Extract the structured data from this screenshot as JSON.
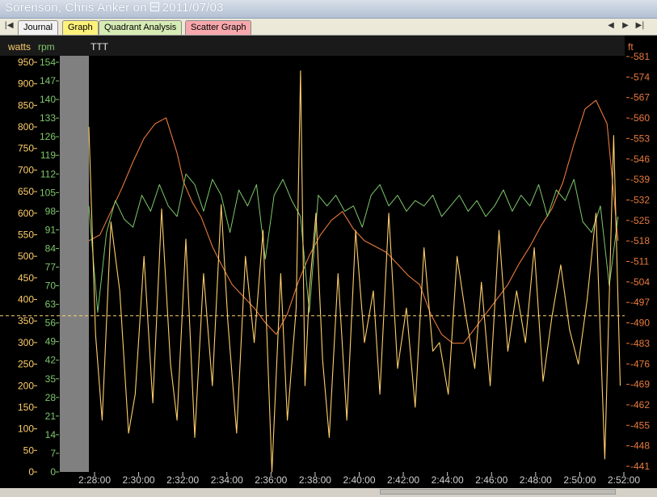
{
  "window": {
    "athlete": "Sorenson, Chris Anker on",
    "date": "2011/07/03"
  },
  "tabs": [
    {
      "label": "Journal",
      "color": "#f2f2f2"
    },
    {
      "label": "Graph",
      "color": "#fff27a"
    },
    {
      "label": "Quadrant Analysis",
      "color": "#d6ecb4"
    },
    {
      "label": "Scatter Graph",
      "color": "#f6a8ad"
    }
  ],
  "colors": {
    "watts": "#ffcf6a",
    "rpm": "#7ec86b",
    "altitude": "#e87a3c",
    "background": "#000000",
    "gray_band": "#808080"
  },
  "chart_data": {
    "type": "line",
    "title": "TTT",
    "axis_labels": {
      "watts": "watts",
      "rpm": "rpm",
      "altitude": "ft"
    },
    "watts_ticks": [
      "950",
      "900",
      "850",
      "800",
      "750",
      "700",
      "650",
      "600",
      "550",
      "500",
      "450",
      "400",
      "350",
      "300",
      "250",
      "200",
      "150",
      "100",
      "50",
      "0"
    ],
    "rpm_ticks": [
      "154",
      "147",
      "140",
      "133",
      "126",
      "119",
      "112",
      "105",
      "98",
      "91",
      "84",
      "77",
      "70",
      "63",
      "56",
      "49",
      "42",
      "35",
      "28",
      "21",
      "14",
      "7",
      "0"
    ],
    "ft_ticks": [
      "-581",
      "-574",
      "-567",
      "-560",
      "-553",
      "-546",
      "-539",
      "-532",
      "-525",
      "-518",
      "-511",
      "-504",
      "-497",
      "-490",
      "-483",
      "-476",
      "-469",
      "-462",
      "-455",
      "-448",
      "-441"
    ],
    "x_ticks": [
      "2:28:00",
      "2:30:00",
      "2:32:00",
      "2:34:00",
      "2:36:00",
      "2:38:00",
      "2:40:00",
      "2:42:00",
      "2:44:00",
      "2:46:00",
      "2:48:00",
      "2:50:00",
      "2:52:00"
    ],
    "x_range_minutes": [
      148,
      172.3
    ],
    "watts_range": [
      0,
      950
    ],
    "rpm_range": [
      0,
      154
    ],
    "ft_range": [
      -441,
      -581
    ],
    "average_watts": 362,
    "series": [
      {
        "name": "watts",
        "x": [
          148.0,
          148.3,
          148.6,
          149.0,
          149.4,
          149.8,
          150.1,
          150.5,
          150.9,
          151.3,
          151.7,
          152.0,
          152.4,
          152.8,
          153.2,
          153.6,
          154.0,
          154.3,
          154.7,
          155.1,
          155.5,
          155.9,
          156.3,
          156.7,
          157.0,
          157.4,
          157.6,
          157.8,
          158.0,
          158.3,
          158.6,
          158.9,
          159.3,
          159.7,
          160.1,
          160.5,
          160.9,
          161.2,
          161.6,
          162.0,
          162.4,
          162.8,
          163.2,
          163.6,
          163.9,
          164.3,
          164.7,
          165.1,
          165.5,
          165.8,
          166.2,
          166.6,
          167.0,
          167.4,
          167.8,
          168.2,
          168.6,
          169.0,
          169.4,
          169.8,
          170.2,
          170.6,
          171.0,
          171.4,
          171.8,
          172.1
        ],
        "values": [
          800,
          320,
          120,
          580,
          420,
          90,
          180,
          500,
          160,
          610,
          250,
          120,
          540,
          80,
          460,
          200,
          620,
          350,
          90,
          500,
          300,
          560,
          0,
          460,
          120,
          380,
          930,
          200,
          420,
          600,
          260,
          80,
          460,
          120,
          560,
          300,
          420,
          180,
          600,
          240,
          380,
          150,
          520,
          280,
          300,
          180,
          500,
          360,
          240,
          440,
          200,
          560,
          280,
          420,
          300,
          520,
          210,
          360,
          480,
          330,
          250,
          400,
          600,
          30,
          780,
          200
        ]
      },
      {
        "name": "rpm",
        "x": [
          148.0,
          148.4,
          148.8,
          149.2,
          149.6,
          150.0,
          150.4,
          150.8,
          151.2,
          151.6,
          152.0,
          152.4,
          152.8,
          153.2,
          153.6,
          154.0,
          154.4,
          154.8,
          155.2,
          155.6,
          156.0,
          156.4,
          156.8,
          157.2,
          157.6,
          158.0,
          158.4,
          158.8,
          159.2,
          159.6,
          160.0,
          160.4,
          160.8,
          161.2,
          161.6,
          162.0,
          162.4,
          162.8,
          163.2,
          163.6,
          164.0,
          164.4,
          164.8,
          165.2,
          165.6,
          166.0,
          166.4,
          166.8,
          167.2,
          167.6,
          168.0,
          168.4,
          168.8,
          169.2,
          169.6,
          170.0,
          170.4,
          170.8,
          171.2,
          171.6,
          172.0
        ],
        "values": [
          100,
          60,
          90,
          102,
          95,
          92,
          104,
          98,
          108,
          100,
          96,
          112,
          108,
          98,
          110,
          104,
          90,
          106,
          100,
          108,
          80,
          104,
          110,
          102,
          96,
          60,
          104,
          100,
          104,
          98,
          100,
          92,
          104,
          108,
          100,
          104,
          98,
          102,
          100,
          104,
          96,
          100,
          104,
          98,
          102,
          96,
          100,
          106,
          98,
          104,
          100,
          108,
          96,
          106,
          102,
          110,
          94,
          90,
          100,
          70,
          96
        ]
      },
      {
        "name": "altitude",
        "x": [
          148.0,
          148.5,
          149.0,
          149.5,
          150.0,
          150.5,
          151.0,
          151.5,
          152.0,
          152.3,
          152.7,
          153.1,
          153.6,
          154.0,
          154.5,
          155.0,
          155.5,
          156.0,
          156.5,
          157.0,
          157.5,
          158.0,
          158.5,
          159.0,
          159.5,
          160.0,
          160.5,
          161.0,
          161.5,
          162.0,
          162.5,
          163.0,
          163.5,
          164.0,
          164.5,
          165.0,
          165.5,
          166.0,
          166.5,
          167.0,
          167.5,
          168.0,
          168.5,
          169.0,
          169.5,
          170.0,
          170.5,
          171.0,
          171.5,
          172.0
        ],
        "values": [
          -520,
          -522,
          -530,
          -538,
          -547,
          -555,
          -560,
          -562,
          -550,
          -540,
          -533,
          -528,
          -518,
          -512,
          -505,
          -501,
          -497,
          -492,
          -488,
          -495,
          -506,
          -515,
          -522,
          -527,
          -530,
          -524,
          -520,
          -518,
          -516,
          -512,
          -508,
          -505,
          -495,
          -488,
          -485,
          -485,
          -490,
          -495,
          -500,
          -505,
          -512,
          -518,
          -525,
          -531,
          -540,
          -553,
          -565,
          -568,
          -560,
          -520
        ]
      }
    ]
  }
}
